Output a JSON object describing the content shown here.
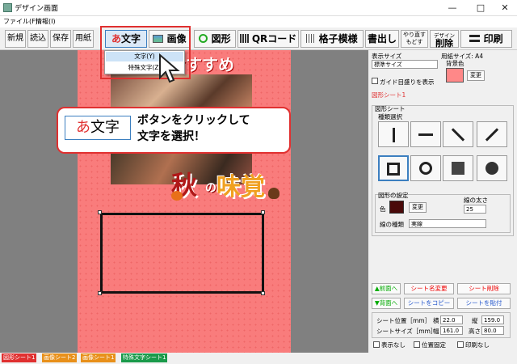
{
  "window": {
    "title": "デザイン画面",
    "min": "—",
    "max": "□",
    "close": "✕"
  },
  "menu": {
    "file": "ファイル(F)",
    "info": "情報(I)"
  },
  "toolbar": {
    "new": "新規",
    "open": "読込",
    "save": "保存",
    "paper": "用紙",
    "text": "文字",
    "image": "画像",
    "shape": "図形",
    "qr": "QRコード",
    "grid": "格子模様",
    "write": "書出し",
    "redo1": "やり直す",
    "redo2": "もどす",
    "design1": "デザイン",
    "design2": "削除",
    "print": "印刷",
    "text_icon": "あ"
  },
  "dropdown": {
    "items": [
      "文字(Y)",
      "特殊文字(Z)"
    ]
  },
  "callout": {
    "icon": "あ",
    "label": "文字",
    "line1": "ボタンをクリックして",
    "line2": "文字を選択！"
  },
  "canvas": {
    "heading": "おすすめ",
    "logo_aki": "秋",
    "logo_no": "の",
    "logo_mikaku": "味覚"
  },
  "right": {
    "display_size_label": "表示サイズ",
    "display_size_value": "標準サイズ",
    "paper_size": "用紙サイズ: A4",
    "guide": "ガイド目盛りを表示",
    "bg_label": "背景色",
    "change": "変更",
    "sheet_name": "図形シート1",
    "sheet_group": "図形シート",
    "shape_sel": "種類選択",
    "shape_settings": "図形の設定",
    "color_label": "色",
    "line_width_label": "線の太さ",
    "line_width_value": "25",
    "line_type_label": "線の種類",
    "line_type_value": "実線",
    "front": "▲前面へ",
    "back": "▼背面へ",
    "rename": "シート名変更",
    "delete": "シート削除",
    "copy": "シートをコピー",
    "paste": "シートを貼付",
    "pos_label": "シート位置［mm］",
    "size_label": "シートサイズ［mm］",
    "x_label": "横",
    "y_label": "縦",
    "w_label": "幅",
    "h_label": "高さ",
    "x_val": "22.0",
    "y_val": "159.0",
    "w_val": "161.0",
    "h_val": "80.0",
    "hide": "表示なし",
    "lock": "位置固定",
    "noprint": "印刷なし"
  },
  "status": {
    "tags": [
      "図形シート1",
      "画像シート2",
      "画像シート1",
      "特殊文字シート1"
    ]
  },
  "colors": {
    "page": "#f97c7c",
    "bg_swatch": "#f88",
    "shape_color": "#4a0a0a",
    "callout_border": "#e03030"
  }
}
